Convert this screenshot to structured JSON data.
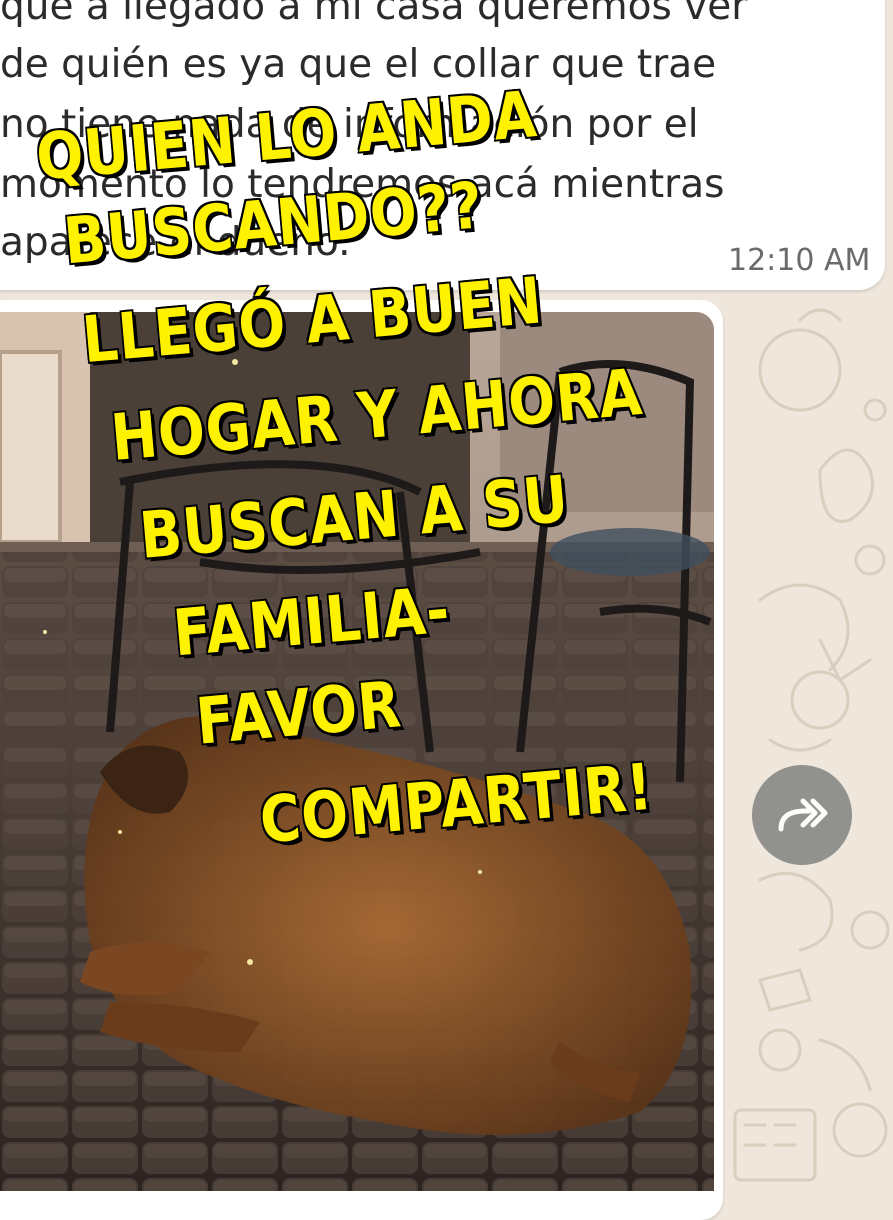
{
  "message": {
    "lines": [
      "que a llegado a mi casa queremos ver",
      "de quién es ya que el collar que trae",
      "no tiene nada de información por el",
      "momento lo tendremos acá mientras",
      "aparece el dueño."
    ],
    "time": "12:10 AM"
  },
  "forward_button": {
    "icon": "forward-icon"
  },
  "overlay_caption": {
    "lines": [
      "QUIEN LO ANDA",
      "BUSCANDO??",
      "LLEGÓ A BUEN",
      "HOGAR Y AHORA",
      "BUSCAN A SU",
      "FAMILIA-",
      "FAVOR",
      "COMPARTIR!"
    ],
    "color": "#fff200",
    "outline": "#000000"
  },
  "photo": {
    "subject": "dog-lying-on-patio-pavers"
  },
  "colors": {
    "wallpaper": "#efe7dc",
    "bubble": "#ffffff",
    "forward_button": "#8a8a88"
  }
}
